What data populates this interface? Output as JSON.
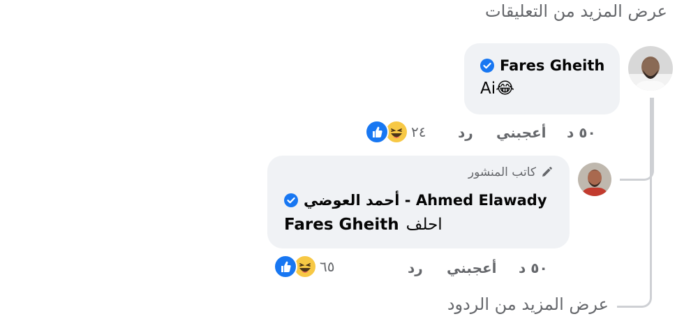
{
  "view_more_comments": "عرض المزيد من التعليقات",
  "view_more_replies": "عرض المزيد من الردود",
  "comments": [
    {
      "author": "Fares Gheith",
      "verified": true,
      "text": "Ai😂",
      "time": "٥٠ د",
      "like_label": "أعجبني",
      "reply_label": "رد",
      "reaction_count": "٢٤",
      "reactions": [
        "like-icon",
        "haha-icon"
      ]
    },
    {
      "author_badge": "كاتب المنشور",
      "author": "أحمد العوضي - Ahmed Elawady",
      "verified": true,
      "text_prefix": "احلف",
      "text_mention": "Fares Gheith",
      "time": "٥٠ د",
      "like_label": "أعجبني",
      "reply_label": "رد",
      "reaction_count": "٦٥",
      "reactions": [
        "like-icon",
        "haha-icon"
      ]
    }
  ],
  "colors": {
    "bubble": "#f0f2f5",
    "secondary_text": "#65676b",
    "verified_blue": "#1877f2",
    "thread_line": "#ced0d4"
  }
}
